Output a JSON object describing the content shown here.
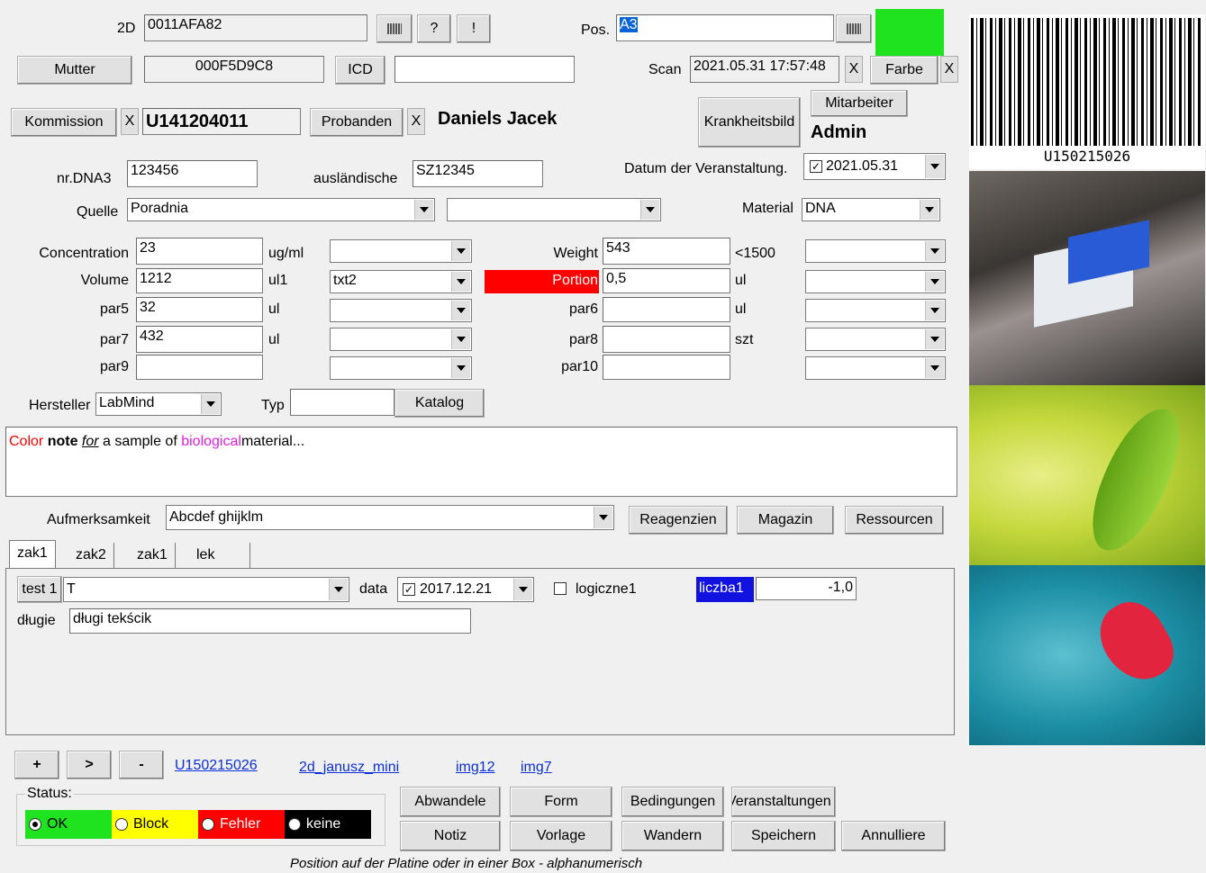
{
  "header": {
    "label_2d": "2D",
    "code_2d": "0011AFA82",
    "btn_question": "?",
    "btn_exclaim": "!",
    "label_pos": "Pos.",
    "pos_value": "A3",
    "btn_mutter": "Mutter",
    "mutter_code": "000F5D9C8",
    "btn_icd": "ICD",
    "icd_value": "",
    "label_scan": "Scan",
    "scan_value": "2021.05.31 17:57:48",
    "x": "X",
    "btn_farbe": "Farbe",
    "btn_kommission": "Kommission",
    "kommission_value": "U141204011",
    "btn_probanden": "Probanden",
    "probanden_value": "Daniels Jacek",
    "btn_krankheitsbild": "Krankheitsbild",
    "btn_mitarbeiter": "Mitarbeiter",
    "mitarbeiter_value": "Admin",
    "color_swatch": "#1ee31e"
  },
  "form": {
    "nr_dna3_label": "nr.DNA3",
    "nr_dna3": "123456",
    "auslandische_label": "ausländische",
    "auslandische": "SZ12345",
    "datum_label": "Datum der Veranstaltung.",
    "datum_value": "2021.05.31",
    "quelle_label": "Quelle",
    "quelle_value": "Poradnia",
    "quelle2_value": "",
    "material_label": "Material",
    "material_value": "DNA",
    "concentration_label": "Concentration",
    "concentration": "23",
    "concentration_unit": "ug/ml",
    "volume_label": "Volume",
    "volume": "1212",
    "volume_unit": "ul1",
    "volume_combo": "txt2",
    "par5_label": "par5",
    "par5": "32",
    "par5_unit": "ul",
    "par7_label": "par7",
    "par7": "432",
    "par7_unit": "ul",
    "par9_label": "par9",
    "par9": "",
    "weight_label": "Weight",
    "weight": "543",
    "weight_unit": "<1500",
    "portion_label": "Portion",
    "portion": "0,5",
    "portion_unit": "ul",
    "par6_label": "par6",
    "par6": "",
    "par6_unit": "ul",
    "par8_label": "par8",
    "par8": "",
    "par8_unit": "szt",
    "par10_label": "par10",
    "par10": "",
    "hersteller_label": "Hersteller",
    "hersteller": "LabMind",
    "typ_label": "Typ",
    "typ": "",
    "btn_katalog": "Katalog",
    "note_parts": [
      "Color",
      "note",
      "for",
      "a sample of",
      "biological",
      "material..."
    ],
    "aufmerksamkeit_label": "Aufmerksamkeit",
    "aufmerksamkeit": "Abcdef ghijklm",
    "btn_reagenzien": "Reagenzien",
    "btn_magazin": "Magazin",
    "btn_ressourcen": "Ressourcen"
  },
  "tabs": [
    "zak1",
    "zak2",
    "zak1",
    "lek"
  ],
  "tab_panel": {
    "test1_label": "test 1",
    "test1_value": "T",
    "data_label": "data",
    "data_value": "2017.12.21",
    "logiczne_label": "logiczne1",
    "liczba_label": "liczba1",
    "liczba_value": "-1,0",
    "dlugie_label": "długie",
    "dlugie_value": "długi tekścik"
  },
  "bottom": {
    "btn_plus": "+",
    "btn_next": ">",
    "btn_minus": "-",
    "links": [
      "U150215026",
      "2d_janusz_mini",
      "img12",
      "img7"
    ],
    "status_label": "Status:",
    "status_options": [
      "OK",
      "Block",
      "Fehler",
      "keine"
    ],
    "status_selected": "OK",
    "row1": [
      "Abwandele",
      "Form",
      "Bedingungen",
      "Veranstaltungen"
    ],
    "row2": [
      "Notiz",
      "Vorlage",
      "Wandern",
      "Speichern",
      "Annulliere"
    ],
    "hint": "Position auf der Platine oder in einer Box - alphanumerisch"
  },
  "side": {
    "barcode_text": "U150215026"
  }
}
